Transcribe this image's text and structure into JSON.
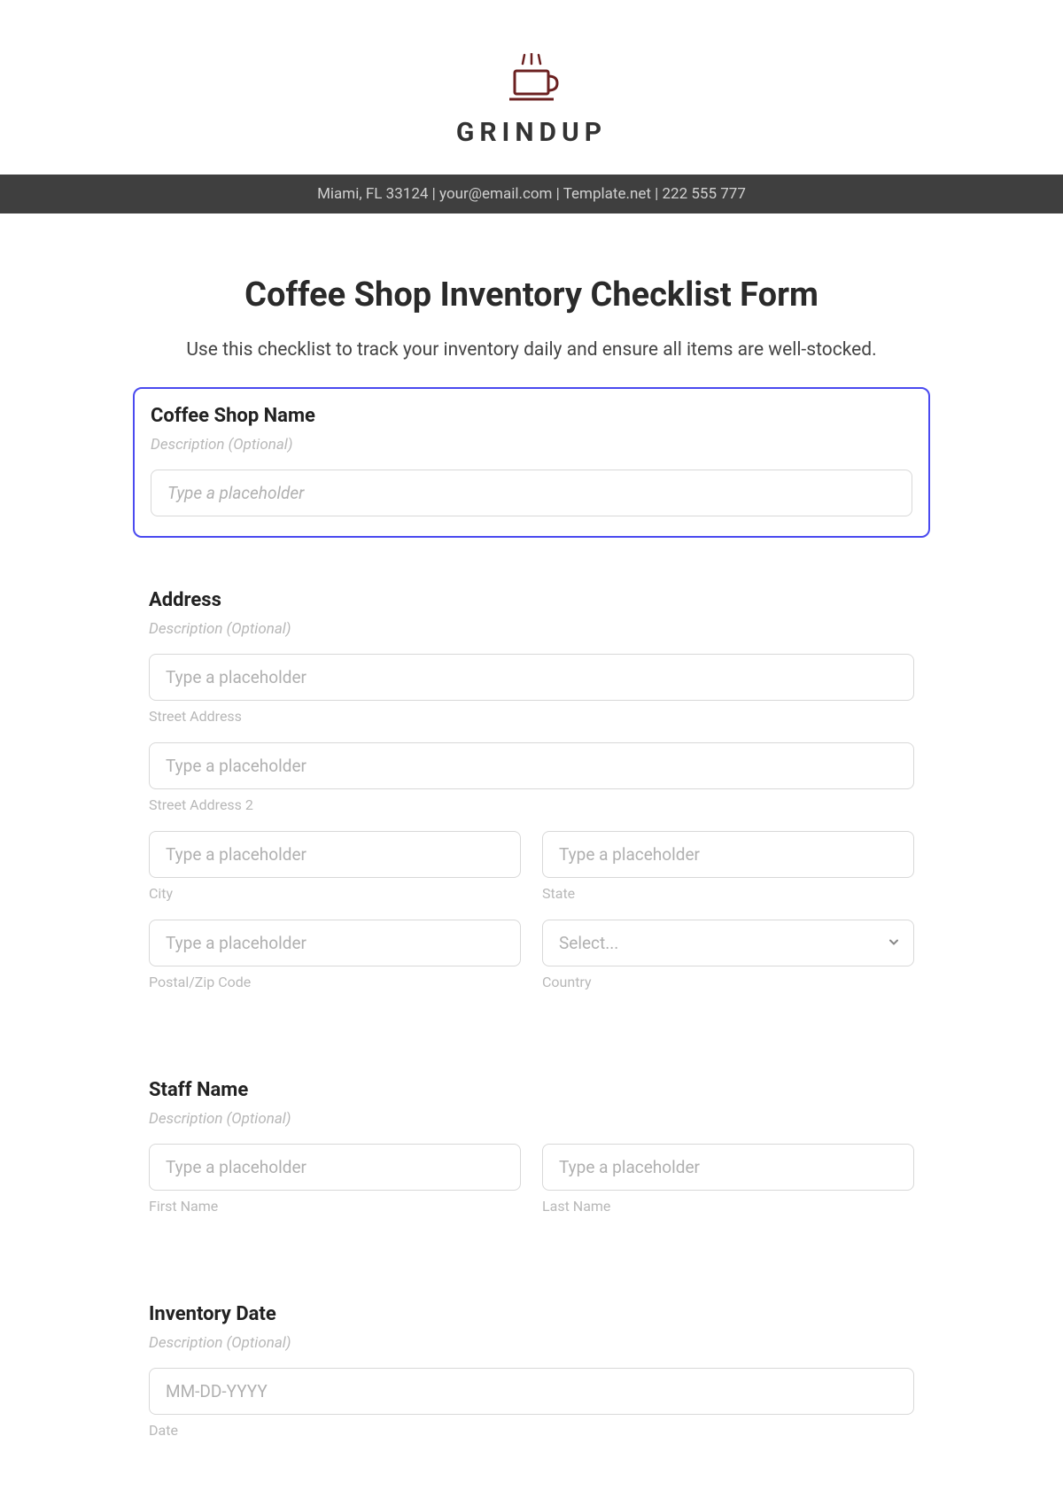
{
  "brand": {
    "name": "GRINDUP",
    "contact": "Miami, FL 33124 | your@email.com | Template.net | 222 555 777"
  },
  "form": {
    "title": "Coffee Shop Inventory Checklist Form",
    "description": "Use this checklist to track your inventory daily and ensure all items are well-stocked."
  },
  "sections": {
    "shop_name": {
      "label": "Coffee Shop Name",
      "desc": "Description (Optional)",
      "placeholder": "Type a placeholder"
    },
    "address": {
      "label": "Address",
      "desc": "Description (Optional)",
      "street": {
        "placeholder": "Type a placeholder",
        "sublabel": "Street Address"
      },
      "street2": {
        "placeholder": "Type a placeholder",
        "sublabel": "Street Address 2"
      },
      "city": {
        "placeholder": "Type a placeholder",
        "sublabel": "City"
      },
      "state": {
        "placeholder": "Type a placeholder",
        "sublabel": "State"
      },
      "postal": {
        "placeholder": "Type a placeholder",
        "sublabel": "Postal/Zip Code"
      },
      "country": {
        "placeholder": "Select...",
        "sublabel": "Country"
      }
    },
    "staff": {
      "label": "Staff Name",
      "desc": "Description (Optional)",
      "first": {
        "placeholder": "Type a placeholder",
        "sublabel": "First Name"
      },
      "last": {
        "placeholder": "Type a placeholder",
        "sublabel": "Last Name"
      }
    },
    "date": {
      "label": "Inventory Date",
      "desc": "Description (Optional)",
      "field": {
        "placeholder": "MM-DD-YYYY",
        "sublabel": "Date"
      }
    }
  }
}
